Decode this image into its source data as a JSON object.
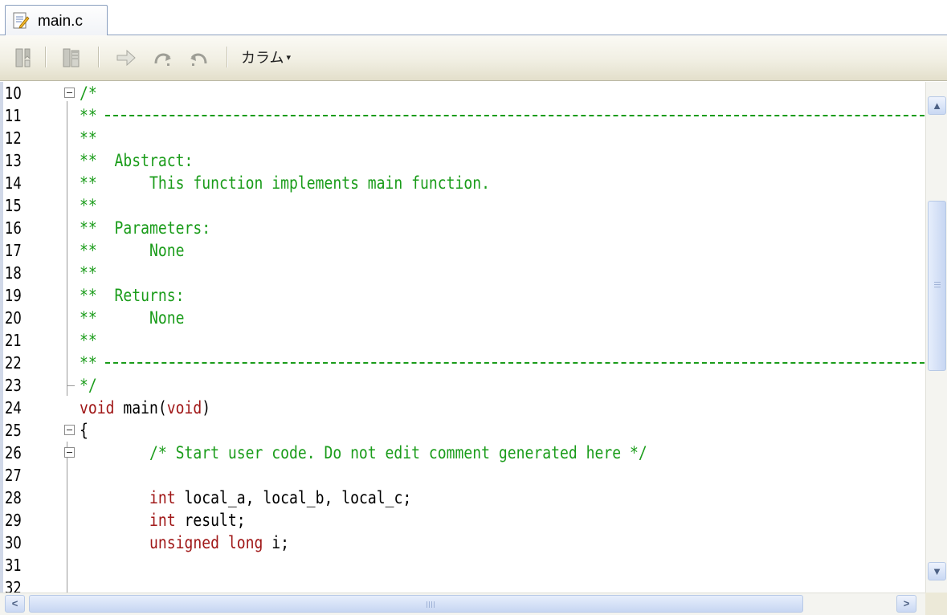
{
  "tab": {
    "filename": "main.c",
    "icon": "document-edit-icon"
  },
  "toolbar": {
    "icons": [
      "bookmark-icon",
      "bookmark-multi-icon",
      "go-to-icon",
      "redo-icon",
      "undo-icon"
    ],
    "menu_label": "カラム",
    "menu_caret": "▾"
  },
  "editor": {
    "lines": [
      {
        "n": "10",
        "text": "/*",
        "kind": "comment",
        "fold": true
      },
      {
        "n": "11",
        "text": "**",
        "kind": "comment",
        "rule": true
      },
      {
        "n": "12",
        "text": "**",
        "kind": "comment"
      },
      {
        "n": "13",
        "text": "**  Abstract:",
        "kind": "comment"
      },
      {
        "n": "14",
        "text": "**      This function implements main function.",
        "kind": "comment"
      },
      {
        "n": "15",
        "text": "**",
        "kind": "comment"
      },
      {
        "n": "16",
        "text": "**  Parameters:",
        "kind": "comment"
      },
      {
        "n": "17",
        "text": "**      None",
        "kind": "comment"
      },
      {
        "n": "18",
        "text": "**",
        "kind": "comment"
      },
      {
        "n": "19",
        "text": "**  Returns:",
        "kind": "comment"
      },
      {
        "n": "20",
        "text": "**      None",
        "kind": "comment"
      },
      {
        "n": "21",
        "text": "**",
        "kind": "comment"
      },
      {
        "n": "22",
        "text": "**",
        "kind": "comment",
        "rule": true
      },
      {
        "n": "23",
        "text": "*/",
        "kind": "comment",
        "corner": true
      },
      {
        "n": "24",
        "text": "void main(void)",
        "kind": "code"
      },
      {
        "n": "25",
        "text": "{",
        "kind": "code",
        "fold": true
      },
      {
        "n": "26",
        "text": "        /* Start user code. Do not edit comment generated here */",
        "kind": "comment",
        "fold": true
      },
      {
        "n": "27",
        "text": "",
        "kind": "code"
      },
      {
        "n": "28",
        "text": "        int local_a, local_b, local_c;",
        "kind": "code"
      },
      {
        "n": "29",
        "text": "        int result;",
        "kind": "code"
      },
      {
        "n": "30",
        "text": "        unsigned long i;",
        "kind": "code"
      },
      {
        "n": "31",
        "text": "",
        "kind": "code"
      },
      {
        "n": "32",
        "text": "",
        "kind": "code"
      }
    ]
  },
  "scrollbars": {
    "vertical": {
      "up_icon": "chevron-up-icon",
      "down_icon": "chevron-down-icon"
    },
    "horizontal": {
      "left_icon": "chevron-left-icon",
      "right_icon": "chevron-right-icon"
    }
  }
}
